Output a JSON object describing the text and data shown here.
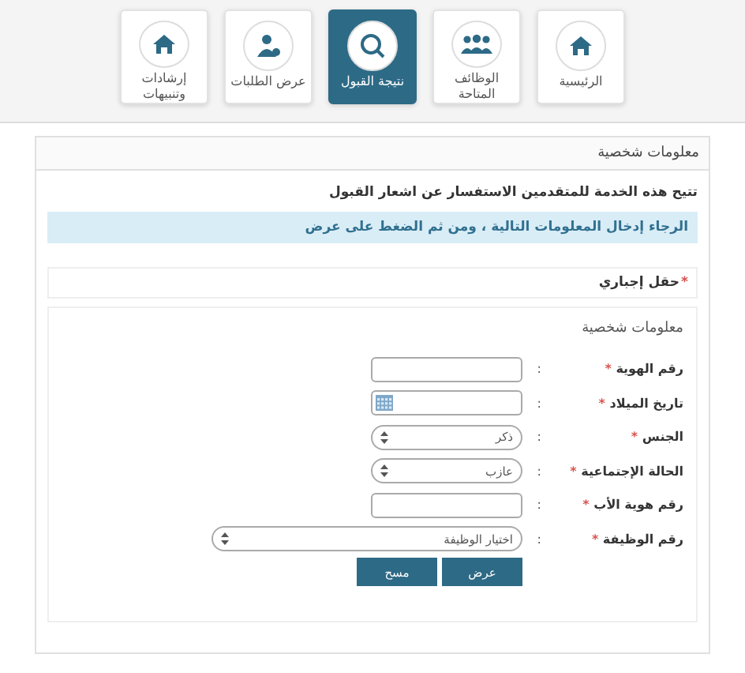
{
  "nav": [
    {
      "label": "الرئيسية",
      "selected": false
    },
    {
      "label": "الوظائف المتاحة",
      "selected": false
    },
    {
      "label": "نتيجة القبول",
      "selected": true
    },
    {
      "label": "عرض الطلبات",
      "selected": false
    },
    {
      "label": "إرشادات وتنبيهات",
      "selected": false
    }
  ],
  "panel": {
    "title": "معلومات شخصية",
    "intro": "تتيح هذه الخدمة للمتقدمين الاستفسار عن اشعار القبول",
    "notice": "الرجاء إدخال المعلومات التالية ، ومن ثم الضغط على عرض",
    "required_mark": "*",
    "required_note": "حقل إجباري"
  },
  "form": {
    "legend": "معلومات شخصية",
    "fields": [
      {
        "label": "رقم الهوية",
        "mark": "*",
        "colon": ":",
        "kind": "text"
      },
      {
        "label": "تاريخ الميلاد",
        "mark": "*",
        "colon": ":",
        "kind": "date"
      },
      {
        "label": "الجنس",
        "mark": "*",
        "colon": ":",
        "kind": "select",
        "value": "ذكر"
      },
      {
        "label": "الحالة الإجتماعية",
        "mark": "*",
        "colon": ":",
        "kind": "select",
        "value": "عازب"
      },
      {
        "label": "رقم هوية الأب",
        "mark": "*",
        "colon": ":",
        "kind": "text"
      },
      {
        "label": "رقم الوظيفة",
        "mark": "*",
        "colon": ":",
        "kind": "wideselect",
        "value": "اختيار الوظيفة"
      }
    ],
    "buttons": [
      "عرض",
      "مسح"
    ]
  }
}
